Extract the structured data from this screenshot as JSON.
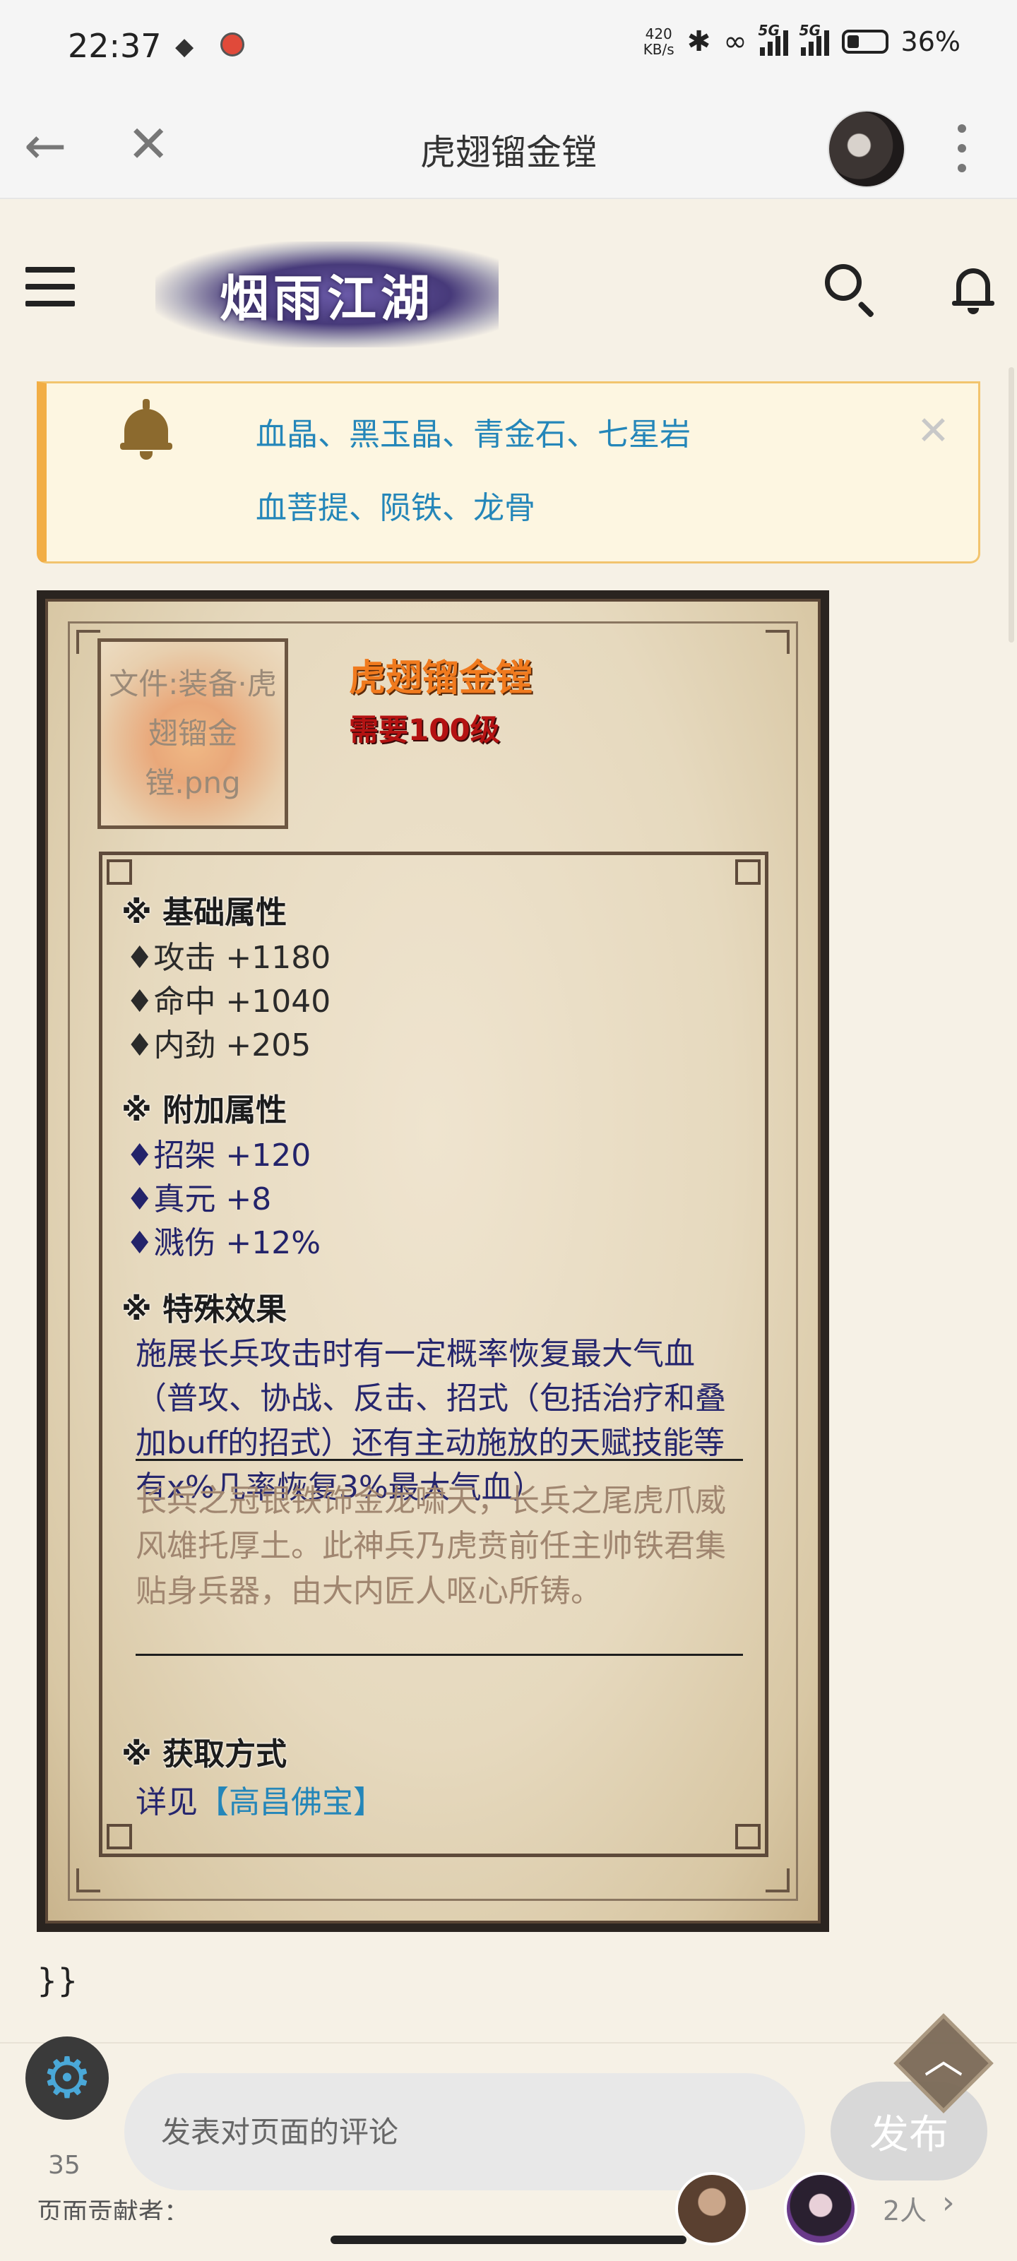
{
  "status_bar": {
    "time": "22:37",
    "speed_value": "420",
    "speed_unit": "KB/s",
    "net1": "5G",
    "net2": "5G",
    "battery": "36%"
  },
  "app_bar": {
    "title": "虎翅镏金镗",
    "back_icon": "arrow-left-icon",
    "close_icon": "close-icon",
    "more_icon": "more-vertical-icon"
  },
  "site": {
    "logo_text": "烟雨江湖"
  },
  "notice": {
    "line1": "血晶、黑玉晶、青金石、七星岩",
    "line2": "血菩提、陨铁、龙骨"
  },
  "item": {
    "image_alt": "文件:装备·虎翅镏金镗.png",
    "name": "虎翅镏金镗",
    "requirement": "需要100级",
    "base_title": "※ 基础属性",
    "base_stats": [
      "♦攻击 +1180",
      "♦命中 +1040",
      "♦内劲 +205"
    ],
    "extra_title": "※ 附加属性",
    "extra_stats": [
      "♦招架 +120",
      "♦真元 +8",
      "♦溅伤 +12%"
    ],
    "effect_title": "※ 特殊效果",
    "effect_text": "施展长兵攻击时有一定概率恢复最大气血（普攻、协战、反击、招式（包括治疗和叠加buff的招式）还有主动施放的天赋技能等有x%几率恢复3%最大气血）",
    "lore": "长兵之冠银铁饰金龙啸天，长兵之尾虎爪威风雄托厚土。此神兵乃虎贲前任主帅铁君集贴身兵器，由大内匠人呕心所铸。",
    "acquire_title": "※ 获取方式",
    "acquire_prefix": "详见",
    "acquire_link": "【高昌佛宝】"
  },
  "closing_braces": "}}",
  "bottom": {
    "like_count": "35",
    "comment_placeholder": "发表对页面的评论",
    "publish_label": "发布",
    "contributors_label": "页面贡献者：",
    "contributors_count": "2人",
    "contributors_arrow": "›"
  },
  "colors": {
    "accent_link": "#2486b9",
    "notice_border": "#f2ae45",
    "item_name": "#f07a1e",
    "requirement": "#b41212",
    "stat_blue": "#23236a",
    "lore": "#a08670"
  }
}
